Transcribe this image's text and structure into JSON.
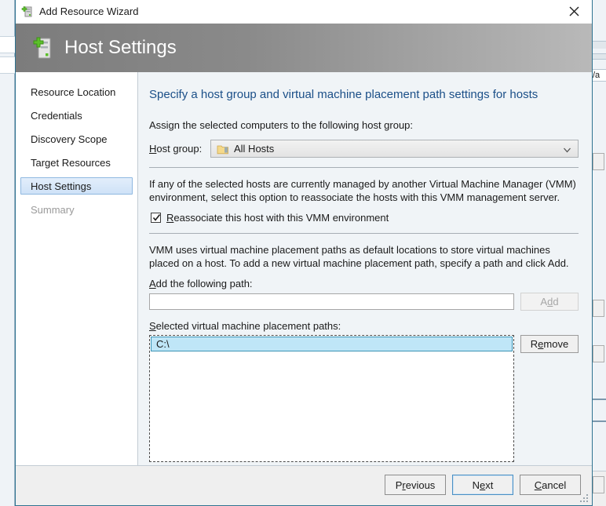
{
  "window": {
    "title": "Add Resource Wizard",
    "title_icon": "server-add-icon",
    "close_icon": "close-icon"
  },
  "header": {
    "title": "Host Settings",
    "icon": "server-add-icon"
  },
  "sidebar": {
    "items": [
      {
        "label": "Resource Location",
        "state": "normal"
      },
      {
        "label": "Credentials",
        "state": "normal"
      },
      {
        "label": "Discovery Scope",
        "state": "normal"
      },
      {
        "label": "Target Resources",
        "state": "normal"
      },
      {
        "label": "Host Settings",
        "state": "selected"
      },
      {
        "label": "Summary",
        "state": "disabled"
      }
    ]
  },
  "content": {
    "heading": "Specify a host group and virtual machine placement path settings for hosts",
    "assign_text": "Assign the selected computers to the following host group:",
    "host_group": {
      "label_pre": "H",
      "label_post": "ost group:",
      "value": "All Hosts",
      "folder_icon": "folder-icon",
      "arrow_icon": "chevron-down-icon"
    },
    "reassociate_paragraph": "If any of the selected hosts are currently managed by another Virtual Machine Manager (VMM) environment, select this option to reassociate the hosts with this VMM management server.",
    "reassociate_checkbox": {
      "checked": true,
      "label_pre": "R",
      "label_post": "eassociate this host with this VMM environment",
      "check_icon": "checkmark-icon"
    },
    "placement_paragraph": "VMM uses virtual machine placement paths as default locations to store virtual machines placed on a host. To add a new virtual machine placement path, specify a path and click Add.",
    "add_path": {
      "label_pre": "A",
      "label_post": "dd the following path:",
      "input_value": "",
      "input_placeholder": "",
      "button_pre": "A",
      "button_mid": "d",
      "button_post": "d",
      "button_enabled": false
    },
    "selected_paths": {
      "label_pre": "S",
      "label_post": "elected virtual machine placement paths:",
      "items": [
        {
          "path": "C:\\",
          "selected": true
        }
      ],
      "remove_button_pre": "R",
      "remove_button_mid": "e",
      "remove_button_post": "move"
    }
  },
  "footer": {
    "previous_pre": "P",
    "previous_mid": "r",
    "previous_post": "evious",
    "next_pre": "N",
    "next_mid": "e",
    "next_post": "xt",
    "cancel_pre": "C",
    "cancel_post": "ancel",
    "resize_grip": "resize-grip-icon"
  },
  "background": {
    "right_window_text": "/a"
  },
  "colors": {
    "accent_blue": "#1b4f88",
    "dialog_border": "#2f7391",
    "selection_blue": "#bfe6f7",
    "nav_selected": "#cfe2f7",
    "header_gray": "#8a8a8a"
  }
}
